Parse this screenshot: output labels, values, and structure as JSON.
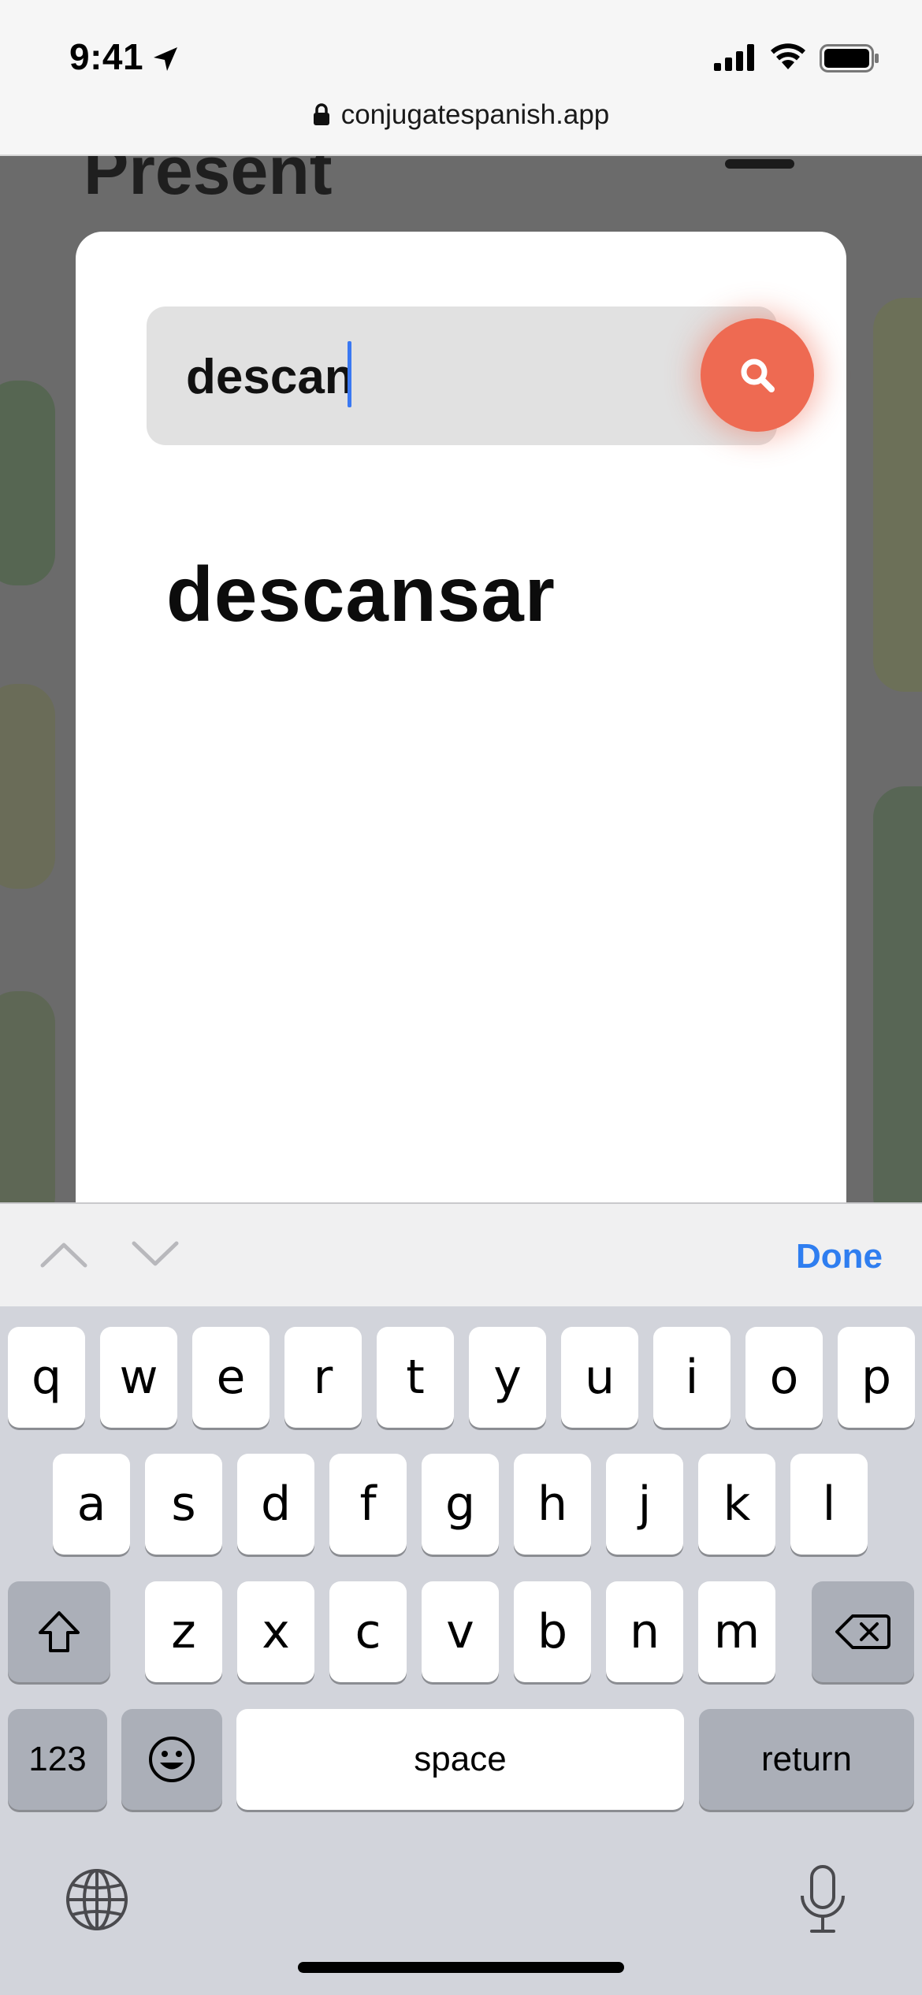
{
  "status_bar": {
    "time": "9:41"
  },
  "browser": {
    "url": "conjugatespanish.app"
  },
  "background_page": {
    "heading": "Present"
  },
  "search": {
    "query": "descan",
    "button_icon": "search-icon",
    "accent_color": "#ee6a52"
  },
  "results": [
    {
      "label": "descansar"
    }
  ],
  "keyboard": {
    "done_label": "Done",
    "row1": [
      "q",
      "w",
      "e",
      "r",
      "t",
      "y",
      "u",
      "i",
      "o",
      "p"
    ],
    "row2": [
      "a",
      "s",
      "d",
      "f",
      "g",
      "h",
      "j",
      "k",
      "l"
    ],
    "row3": [
      "z",
      "x",
      "c",
      "v",
      "b",
      "n",
      "m"
    ],
    "numbers_label": "123",
    "space_label": "space",
    "return_label": "return"
  }
}
